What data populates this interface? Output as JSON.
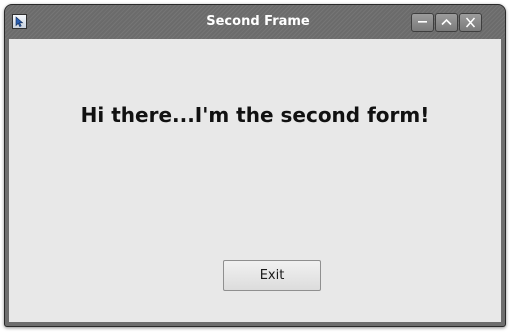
{
  "window": {
    "title": "Second Frame"
  },
  "titlebar_buttons": {
    "minimize_icon": "minimize-icon",
    "maximize_icon": "maximize-icon",
    "close_icon": "close-icon"
  },
  "content": {
    "greeting": "Hi there...I'm the second form!",
    "exit_label": "Exit"
  },
  "colors": {
    "titlebar": "#6b6b6b",
    "content_background": "#e8e8e8",
    "title_text": "#ffffff"
  }
}
